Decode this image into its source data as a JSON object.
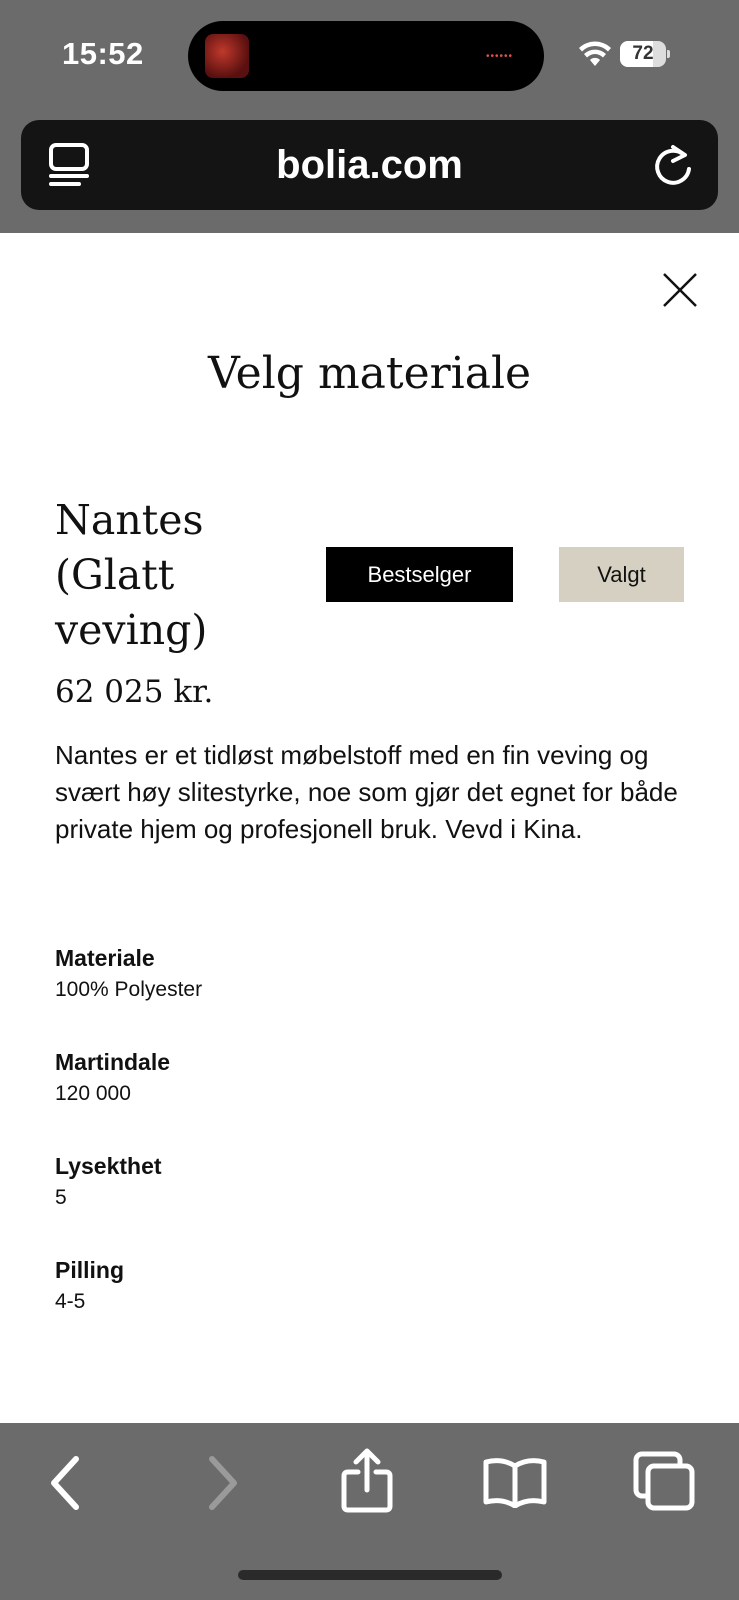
{
  "status_bar": {
    "time": "15:52",
    "battery_percent": "72",
    "battery_level": 0.72,
    "icons": [
      "wifi-icon",
      "battery-icon"
    ]
  },
  "browser": {
    "url": "bolia.com",
    "icons": [
      "tabs-overview-icon",
      "reload-icon"
    ]
  },
  "modal": {
    "title": "Velg materiale",
    "close_icon": "close-icon",
    "product": {
      "name": "Nantes (Glatt veving)",
      "badge_bestseller": "Bestselger",
      "badge_selected": "Valgt",
      "price": "62 025 kr.",
      "description": "Nantes er et tidløst møbelstoff med en fin veving og svært høy slitestyrke, noe som gjør det egnet for både private hjem og profesjonell bruk. Vevd i Kina."
    },
    "specs": [
      {
        "label": "Materiale",
        "value": "100% Polyester"
      },
      {
        "label": "Martindale",
        "value": "120 000"
      },
      {
        "label": "Lysekthet",
        "value": "5"
      },
      {
        "label": "Pilling",
        "value": "4-5"
      }
    ]
  },
  "toolbar": {
    "icons": [
      "back-icon",
      "forward-icon",
      "share-icon",
      "bookmarks-icon",
      "tabs-icon"
    ]
  },
  "colors": {
    "chrome_gray": "#6b6b6b",
    "url_bar": "#141414",
    "badge_bestseller_bg": "#000000",
    "badge_selected_bg": "#d6d0c2"
  }
}
